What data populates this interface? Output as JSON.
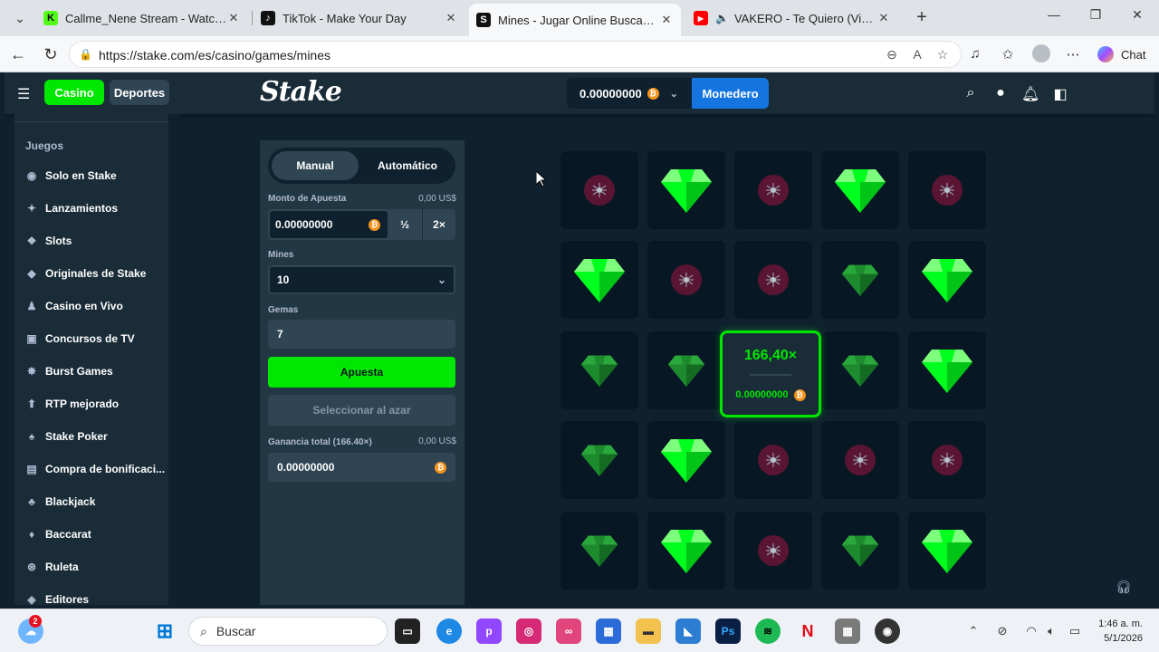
{
  "browser": {
    "tabs": [
      {
        "title": "Callme_Nene Stream - Watch Live",
        "favicon": "kick",
        "color": "#53fc18",
        "glyph": "K"
      },
      {
        "title": "TikTok - Make Your Day",
        "favicon": "tiktok",
        "color": "#111111",
        "glyph": "♪"
      },
      {
        "title": "Mines - Jugar Online Buscaminas c",
        "favicon": "stake",
        "color": "#111111",
        "glyph": "S"
      },
      {
        "title": "VAKERO - Te Quiero (Video Of",
        "favicon": "youtube",
        "color": "#ff0000",
        "glyph": "▶"
      }
    ],
    "url": "https://stake.com/es/casino/games/mines",
    "chat_label": "Chat"
  },
  "stake": {
    "nav": {
      "casino": "Casino",
      "sports": "Deportes"
    },
    "logo": "Stake",
    "wallet": {
      "balance": "0.00000000",
      "button": "Monedero"
    },
    "sidebar": {
      "heading": "Juegos",
      "items": [
        {
          "label": "Solo en Stake",
          "icon": "stake-icon"
        },
        {
          "label": "Lanzamientos",
          "icon": "sparkle-icon"
        },
        {
          "label": "Slots",
          "icon": "slots-icon"
        },
        {
          "label": "Originales de Stake",
          "icon": "fire-icon"
        },
        {
          "label": "Casino en Vivo",
          "icon": "live-icon"
        },
        {
          "label": "Concursos de TV",
          "icon": "tv-icon"
        },
        {
          "label": "Burst Games",
          "icon": "burst-icon"
        },
        {
          "label": "RTP mejorado",
          "icon": "rtp-icon"
        },
        {
          "label": "Stake Poker",
          "icon": "poker-icon"
        },
        {
          "label": "Compra de bonificaci...",
          "icon": "gift-icon"
        },
        {
          "label": "Blackjack",
          "icon": "cards-icon"
        },
        {
          "label": "Baccarat",
          "icon": "diamond-icon"
        },
        {
          "label": "Ruleta",
          "icon": "roulette-icon"
        },
        {
          "label": "Editores",
          "icon": "editor-icon"
        }
      ]
    },
    "panel": {
      "tab_manual": "Manual",
      "tab_auto": "Automático",
      "bet_label": "Monto de Apuesta",
      "bet_usd": "0,00 US$",
      "bet_value": "0.00000000",
      "half": "½",
      "double": "2×",
      "mines_label": "Mines",
      "mines_value": "10",
      "gems_label": "Gemas",
      "gems_value": "7",
      "bet_button": "Apuesta",
      "random_button": "Seleccionar al azar",
      "profit_label": "Ganancia total (166.40×)",
      "profit_usd": "0,00 US$",
      "profit_value": "0.00000000"
    },
    "grid": [
      [
        "mine",
        "gem",
        "mine",
        "gem",
        "mine"
      ],
      [
        "gem",
        "mine",
        "mine",
        "gem-dim",
        "gem"
      ],
      [
        "gem-dim",
        "gem-dim",
        "popup",
        "gem-dim",
        "gem"
      ],
      [
        "gem-dim",
        "gem",
        "mine",
        "mine",
        "mine"
      ],
      [
        "gem-dim",
        "gem",
        "mine",
        "gem-dim",
        "gem"
      ]
    ],
    "result": {
      "multiplier": "166,40×",
      "payout": "0.00000000"
    },
    "colors": {
      "green": "#00e701",
      "blue": "#1475e1",
      "mine": "#5a1532"
    }
  },
  "taskbar": {
    "search": "Buscar",
    "time": "1:46 a. m.",
    "date": "5/1/2026",
    "badge": "2"
  }
}
